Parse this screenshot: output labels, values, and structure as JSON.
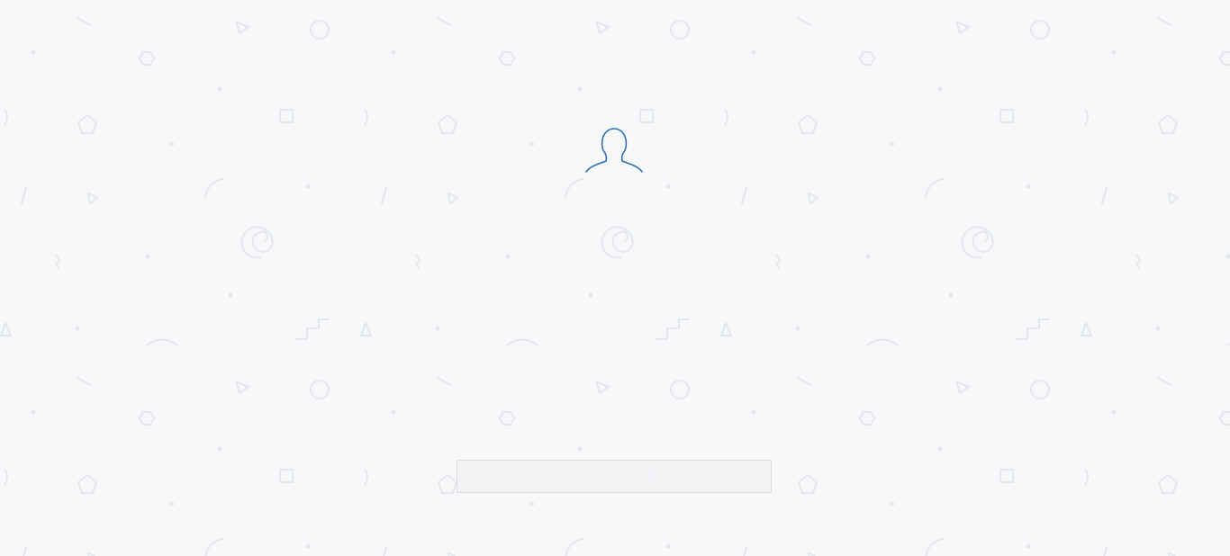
{
  "background": {
    "color": "#f7f8fa",
    "pattern_color": "#e4e7eb",
    "pattern": "doodle-shapes"
  },
  "user": {
    "avatar_icon": "user-silhouette-icon",
    "avatar_color": "#2f6fad"
  },
  "login": {
    "input_value": "",
    "input_placeholder": ""
  }
}
